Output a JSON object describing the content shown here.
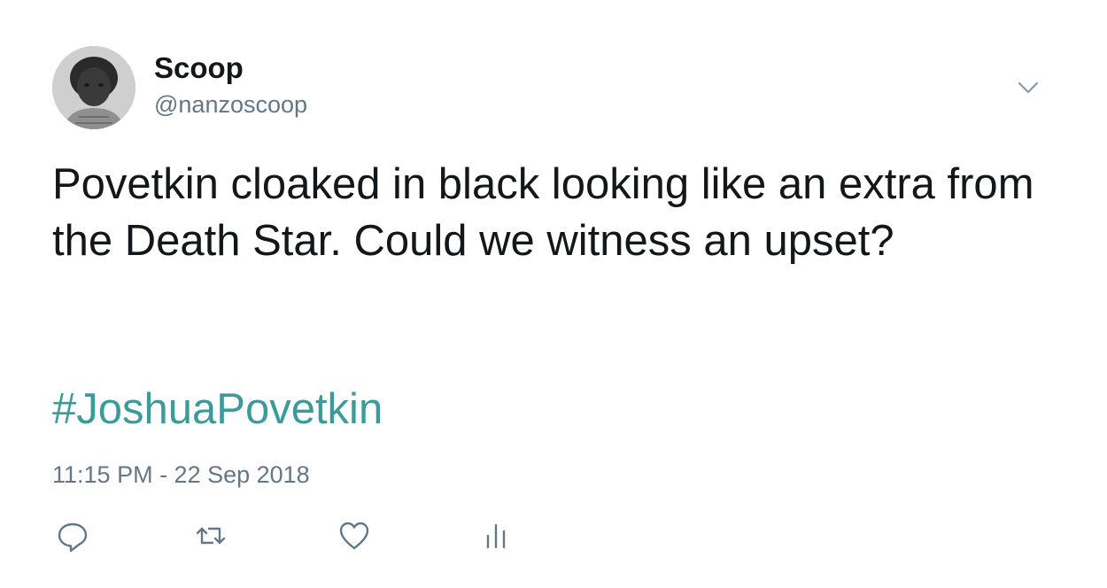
{
  "author": {
    "display_name": "Scoop",
    "handle": "@nanzoscoop",
    "avatar_icon": "profile-photo"
  },
  "tweet": {
    "text": "Povetkin cloaked in black looking like an extra from the Death Star. Could we witness an upset?",
    "hashtag": "#JoshuaPovetkin",
    "timestamp": "11:15 PM - 22 Sep 2018"
  },
  "actions": [
    {
      "name": "reply",
      "icon": "speech-bubble-icon"
    },
    {
      "name": "retweet",
      "icon": "retweet-arrows-icon"
    },
    {
      "name": "like",
      "icon": "heart-icon"
    },
    {
      "name": "analytics",
      "icon": "bar-chart-icon"
    }
  ],
  "colors": {
    "text": "#14171a",
    "secondary": "#657786",
    "hashtag": "#3b9a9a",
    "background": "#ffffff"
  }
}
